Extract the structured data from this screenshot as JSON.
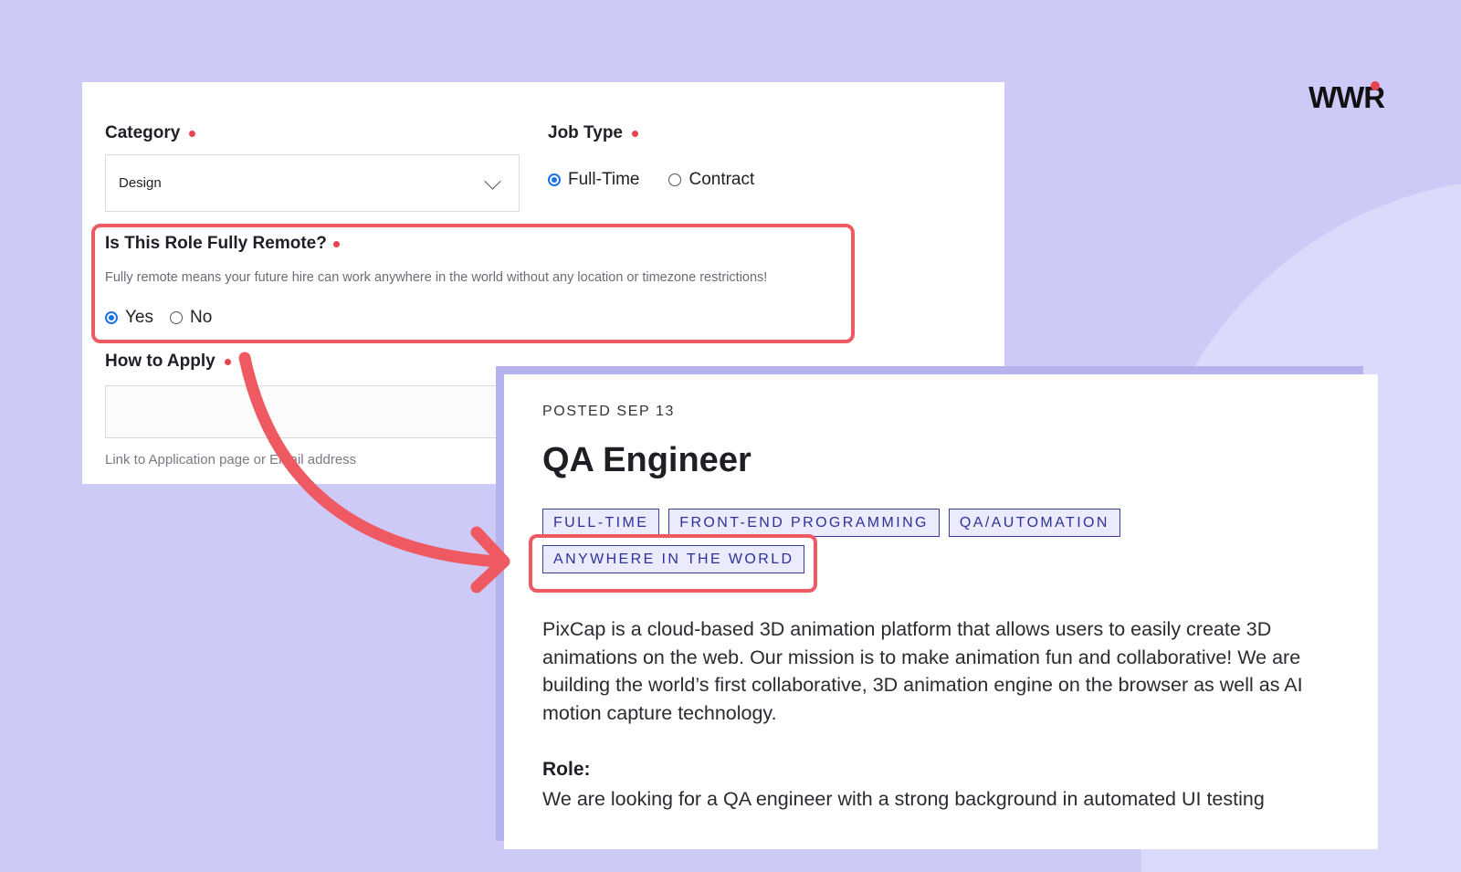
{
  "brand": {
    "logo_text": "WWR",
    "accent_color": "#e8434e"
  },
  "form": {
    "category": {
      "label": "Category",
      "selected_value": "Design"
    },
    "job_type": {
      "label": "Job Type",
      "options": [
        {
          "label": "Full-Time",
          "selected": true
        },
        {
          "label": "Contract",
          "selected": false
        }
      ]
    },
    "remote": {
      "label": "Is This Role Fully Remote?",
      "help": "Fully remote means your future hire can work anywhere in the world without any location or timezone restrictions!",
      "options": [
        {
          "label": "Yes",
          "selected": true
        },
        {
          "label": "No",
          "selected": false
        }
      ]
    },
    "how_to_apply": {
      "label": "How to Apply",
      "value": "",
      "help": "Link to Application page or Email address"
    }
  },
  "job": {
    "posted": "POSTED SEP 13",
    "title": "QA Engineer",
    "tags": [
      "FULL-TIME",
      "FRONT-END PROGRAMMING",
      "QA/AUTOMATION",
      "ANYWHERE IN THE WORLD"
    ],
    "description": "PixCap is a cloud-based 3D animation platform that allows users to easily create 3D animations on the web. Our mission is to make animation fun and collaborative! We are building the world’s first collaborative, 3D animation engine on the browser as well as AI motion capture technology.",
    "role_heading": "Role:",
    "role_text": "We are looking for a QA engineer with a strong background in automated UI testing"
  },
  "annotations": {
    "highlight_color": "#ef5a62"
  }
}
